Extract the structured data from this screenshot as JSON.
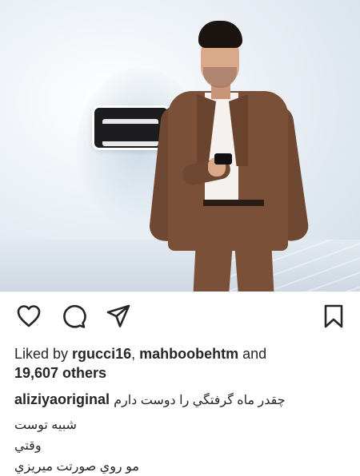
{
  "post": {
    "image_alt": "",
    "likes": {
      "prefix": "Liked by ",
      "user1": "rgucci16",
      "separator": ", ",
      "user2": "mahboobehtm",
      "conjunction": " and",
      "others": "19,607 others"
    },
    "caption": {
      "username": "aliziyaoriginal",
      "line1": "چقدر ماه گرفتگي را دوست دارم",
      "line2": "شبيه توست",
      "line3": "وقتي",
      "line4": "مو روي صورتت ميريزي"
    }
  },
  "icons": {
    "like": "heart-icon",
    "comment": "comment-icon",
    "share": "paper-plane-icon",
    "save": "bookmark-icon"
  },
  "colors": {
    "text": "#262626",
    "icon": "#262626",
    "background": "#ffffff"
  }
}
